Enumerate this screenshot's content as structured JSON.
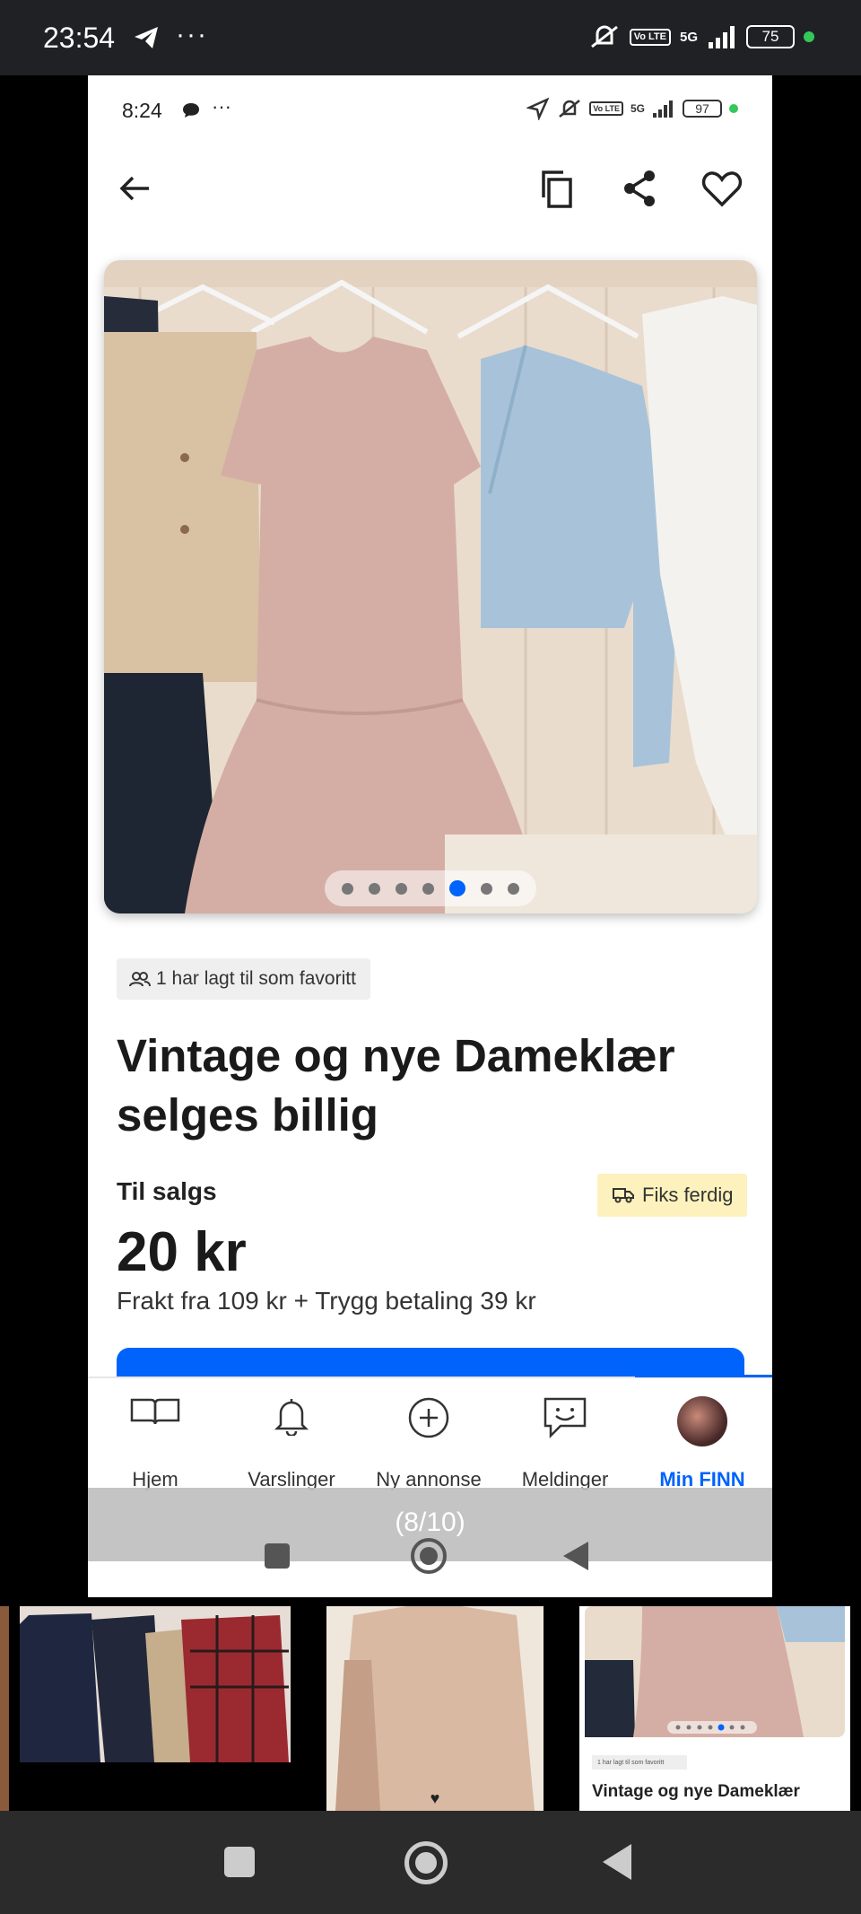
{
  "outer_status": {
    "time": "23:54",
    "dots": "···",
    "network": "5G",
    "volte": "Vo LTE",
    "battery": "75"
  },
  "inner_status": {
    "time": "8:24",
    "dots": "···",
    "network": "5G",
    "volte": "Vo LTE",
    "battery": "97"
  },
  "listing": {
    "favorite_count_text": "1 har lagt til som favoritt",
    "title": "Vintage og nye Dameklær selges billig",
    "status": "Til salgs",
    "shipping_badge": "Fiks ferdig",
    "price": "20 kr",
    "shipping_text": "Frakt fra 109 kr + Trygg betaling 39 kr",
    "image_dots": {
      "count": 7,
      "active_index": 4
    }
  },
  "bottom_nav": {
    "items": [
      {
        "label": "Hjem",
        "icon": "book-icon"
      },
      {
        "label": "Varslinger",
        "icon": "bell-icon"
      },
      {
        "label": "Ny annonse",
        "icon": "plus-circle-icon"
      },
      {
        "label": "Meldinger",
        "icon": "chat-icon"
      },
      {
        "label": "Min FINN",
        "icon": "avatar"
      }
    ],
    "active_index": 4
  },
  "gallery": {
    "counter": "(8/10)"
  },
  "thumbnails": {
    "preview_chip": "1 har lagt til som favoritt",
    "preview_title": "Vintage og nye Dameklær"
  },
  "colors": {
    "accent": "#0063fb",
    "badge_bg": "#fdf2bd"
  }
}
